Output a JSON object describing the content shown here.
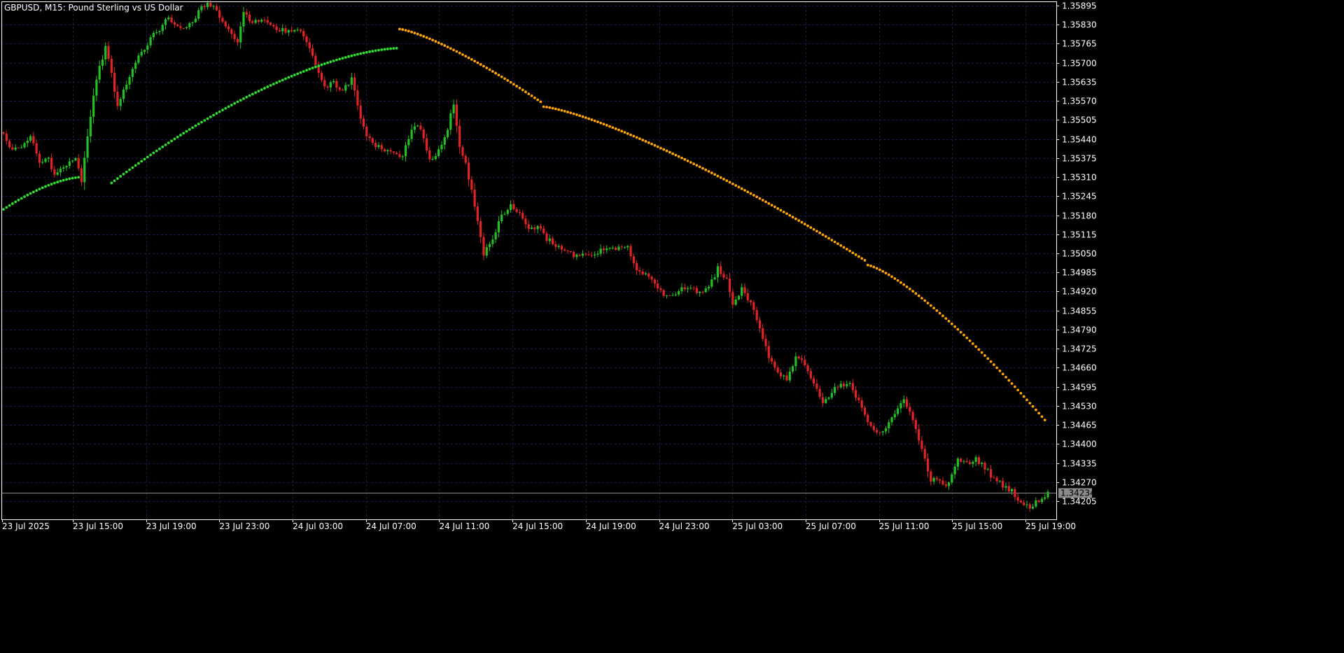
{
  "window": {
    "title": "GBPUSD, M15:  Pound Sterling vs US Dollar"
  },
  "colors": {
    "background": "#000000",
    "grid": "#1a1a4d",
    "frame": "#ffffff",
    "bull": "#22c022",
    "bear": "#e02424",
    "sar_up": "#2ee02e",
    "sar_down": "#ffa500",
    "bid_line": "#8a8a8a",
    "text": "#ffffff"
  },
  "chart_data": {
    "type": "candlestick",
    "symbol": "GBPUSD",
    "timeframe": "M15",
    "ylim": [
      1.34165,
      1.35915
    ],
    "grid": true,
    "y_ticks": [
      "1.35895",
      "1.35830",
      "1.35765",
      "1.35700",
      "1.35635",
      "1.35570",
      "1.35505",
      "1.35440",
      "1.35375",
      "1.35310",
      "1.35245",
      "1.35180",
      "1.35115",
      "1.35050",
      "1.34985",
      "1.34920",
      "1.34855",
      "1.34790",
      "1.34725",
      "1.34660",
      "1.34595",
      "1.34530",
      "1.34465",
      "1.34400",
      "1.34335",
      "1.34270",
      "1.34205"
    ],
    "x_ticks": [
      "23 Jul 2025",
      "23 Jul 15:00",
      "23 Jul 19:00",
      "23 Jul 23:00",
      "24 Jul 03:00",
      "24 Jul 07:00",
      "24 Jul 11:00",
      "24 Jul 15:00",
      "24 Jul 19:00",
      "24 Jul 23:00",
      "25 Jul 03:00",
      "25 Jul 07:00",
      "25 Jul 11:00",
      "25 Jul 15:00",
      "25 Jul 19:00"
    ],
    "current_price": "1.34234",
    "anchor_closes": [
      [
        0,
        1.3545
      ],
      [
        3,
        1.354
      ],
      [
        6,
        1.3541
      ],
      [
        9,
        1.3545
      ],
      [
        12,
        1.3536
      ],
      [
        15,
        1.3537
      ],
      [
        17,
        1.3532
      ],
      [
        20,
        1.3535
      ],
      [
        24,
        1.3537
      ],
      [
        26,
        1.353
      ],
      [
        28,
        1.3545
      ],
      [
        31,
        1.3565
      ],
      [
        34,
        1.3575
      ],
      [
        36,
        1.3566
      ],
      [
        38,
        1.3555
      ],
      [
        41,
        1.3563
      ],
      [
        44,
        1.357
      ],
      [
        47,
        1.3575
      ],
      [
        50,
        1.358
      ],
      [
        53,
        1.3582
      ],
      [
        55,
        1.3586
      ],
      [
        58,
        1.3582
      ],
      [
        61,
        1.3583
      ],
      [
        63,
        1.3584
      ],
      [
        66,
        1.3589
      ],
      [
        69,
        1.359
      ],
      [
        72,
        1.3586
      ],
      [
        75,
        1.3581
      ],
      [
        78,
        1.3577
      ],
      [
        80,
        1.3587
      ],
      [
        83,
        1.3584
      ],
      [
        86,
        1.3585
      ],
      [
        89,
        1.3583
      ],
      [
        92,
        1.3581
      ],
      [
        95,
        1.3581
      ],
      [
        98,
        1.3582
      ],
      [
        101,
        1.3577
      ],
      [
        104,
        1.357
      ],
      [
        107,
        1.3562
      ],
      [
        110,
        1.3563
      ],
      [
        113,
        1.356
      ],
      [
        116,
        1.3565
      ],
      [
        118,
        1.3555
      ],
      [
        121,
        1.3545
      ],
      [
        124,
        1.3542
      ],
      [
        127,
        1.354
      ],
      [
        130,
        1.3539
      ],
      [
        133,
        1.3538
      ],
      [
        136,
        1.3548
      ],
      [
        139,
        1.3548
      ],
      [
        142,
        1.3537
      ],
      [
        145,
        1.354
      ],
      [
        148,
        1.3548
      ],
      [
        150,
        1.3556
      ],
      [
        152,
        1.3541
      ],
      [
        154,
        1.3536
      ],
      [
        157,
        1.3521
      ],
      [
        160,
        1.3505
      ],
      [
        163,
        1.351
      ],
      [
        166,
        1.3518
      ],
      [
        169,
        1.3521
      ],
      [
        172,
        1.3518
      ],
      [
        175,
        1.3514
      ],
      [
        178,
        1.3514
      ],
      [
        181,
        1.351
      ],
      [
        184,
        1.3508
      ],
      [
        187,
        1.3506
      ],
      [
        190,
        1.3504
      ],
      [
        193,
        1.3505
      ],
      [
        196,
        1.3505
      ],
      [
        199,
        1.3506
      ],
      [
        202,
        1.3507
      ],
      [
        205,
        1.3507
      ],
      [
        208,
        1.3507
      ],
      [
        211,
        1.35
      ],
      [
        214,
        1.3498
      ],
      [
        217,
        1.3495
      ],
      [
        220,
        1.3491
      ],
      [
        223,
        1.349
      ],
      [
        226,
        1.3493
      ],
      [
        229,
        1.3494
      ],
      [
        232,
        1.3491
      ],
      [
        235,
        1.3493
      ],
      [
        238,
        1.35
      ],
      [
        241,
        1.3496
      ],
      [
        243,
        1.3488
      ],
      [
        246,
        1.3493
      ],
      [
        249,
        1.3488
      ],
      [
        252,
        1.348
      ],
      [
        255,
        1.347
      ],
      [
        258,
        1.3464
      ],
      [
        261,
        1.3462
      ],
      [
        264,
        1.347
      ],
      [
        267,
        1.3467
      ],
      [
        270,
        1.346
      ],
      [
        273,
        1.3454
      ],
      [
        276,
        1.3458
      ],
      [
        279,
        1.346
      ],
      [
        282,
        1.346
      ],
      [
        285,
        1.3455
      ],
      [
        288,
        1.3448
      ],
      [
        291,
        1.3444
      ],
      [
        294,
        1.3445
      ],
      [
        297,
        1.345
      ],
      [
        300,
        1.3456
      ],
      [
        303,
        1.3448
      ],
      [
        306,
        1.3438
      ],
      [
        309,
        1.3428
      ],
      [
        312,
        1.3427
      ],
      [
        315,
        1.3426
      ],
      [
        318,
        1.3435
      ],
      [
        321,
        1.3433
      ],
      [
        324,
        1.3435
      ],
      [
        327,
        1.3432
      ],
      [
        330,
        1.3428
      ],
      [
        333,
        1.3426
      ],
      [
        336,
        1.3424
      ],
      [
        339,
        1.342
      ],
      [
        342,
        1.3418
      ],
      [
        345,
        1.3421
      ],
      [
        348,
        1.3423
      ]
    ],
    "parabolic_sar": {
      "up_segments": [
        {
          "from": 0,
          "to": 26,
          "start": 1.352,
          "end": 1.3531
        },
        {
          "from": 36,
          "to": 132,
          "start": 1.3529,
          "end": 1.3575
        }
      ],
      "down_segments": [
        {
          "from": 132,
          "to": 180,
          "start": 1.35815,
          "end": 1.3556
        },
        {
          "from": 180,
          "to": 288,
          "start": 1.3555,
          "end": 1.3502
        },
        {
          "from": 288,
          "to": 348,
          "start": 1.3501,
          "end": 1.3447
        }
      ]
    }
  }
}
